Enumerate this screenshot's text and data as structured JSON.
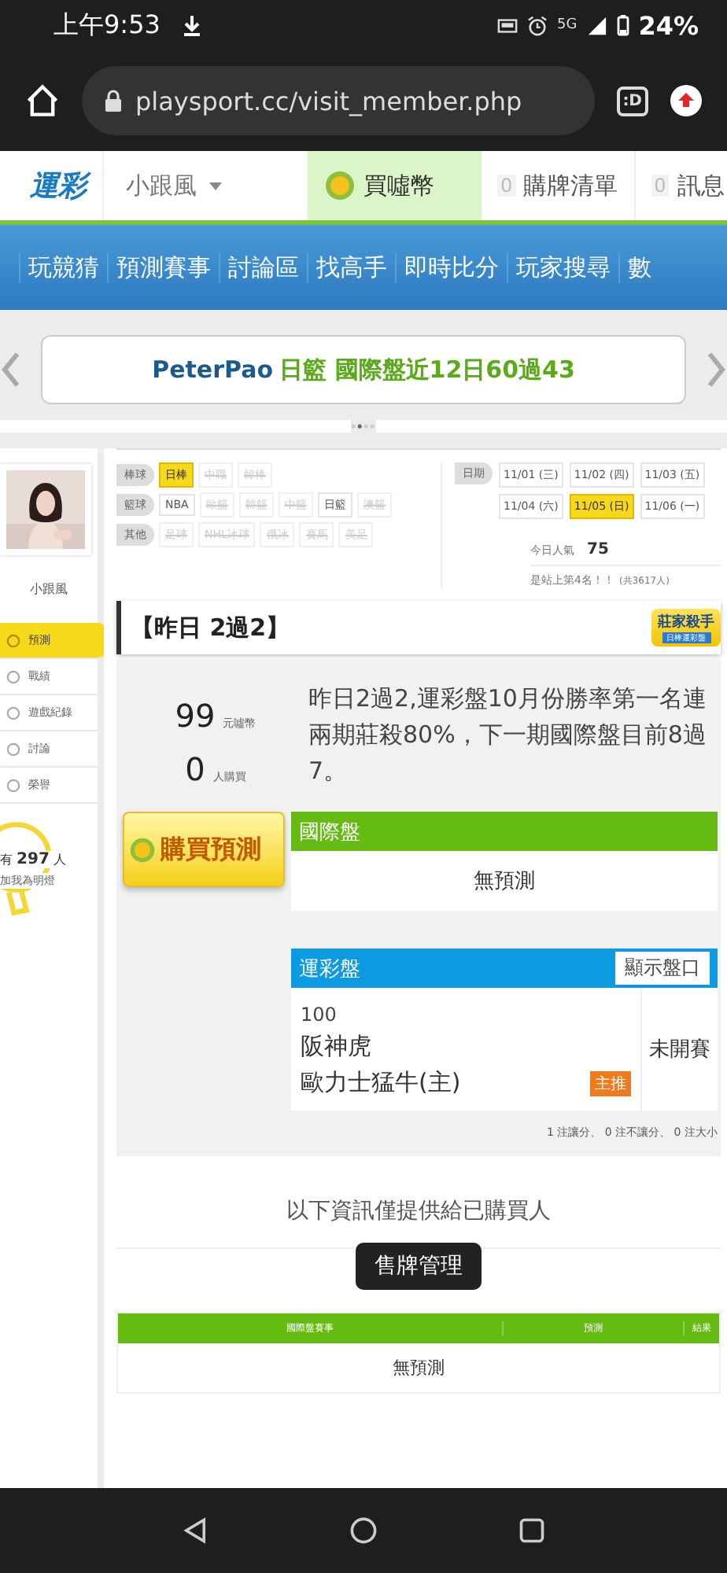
{
  "status_bar": {
    "time": "上午9:53",
    "network": "5G",
    "battery": "24%"
  },
  "browser": {
    "url": "playsport.cc/visit_member.php",
    "tab_button": ":D"
  },
  "site_header": {
    "logo": "運彩",
    "user": "小跟風",
    "buy_coin": "買噓幣",
    "cart": {
      "count": "0",
      "label": "購牌清單"
    },
    "messages": {
      "count": "0",
      "label": "訊息"
    }
  },
  "nav": [
    "玩競猜",
    "預測賽事",
    "討論區",
    "找高手",
    "即時比分",
    "玩家搜尋",
    "數"
  ],
  "banner": {
    "name": "PeterPao",
    "text": "日籃 國際盤近12日60過43"
  },
  "profile": {
    "name": "小跟風",
    "menu": [
      {
        "label": "預測",
        "selected": true
      },
      {
        "label": "戰績",
        "selected": false
      },
      {
        "label": "遊戲紀錄",
        "selected": false
      },
      {
        "label": "討論",
        "selected": false
      },
      {
        "label": "榮譽",
        "selected": false
      }
    ],
    "fans": {
      "prefix": "有",
      "count": "297",
      "unit": "人",
      "caption": "加我為明燈"
    }
  },
  "filters": {
    "groups": [
      {
        "label": "棒球",
        "items": [
          {
            "label": "日棒",
            "selected": true,
            "disabled": false
          },
          {
            "label": "中職",
            "selected": false,
            "disabled": true
          },
          {
            "label": "韓棒",
            "selected": false,
            "disabled": true
          }
        ]
      },
      {
        "label": "籃球",
        "items": [
          {
            "label": "NBA",
            "selected": false,
            "disabled": false
          },
          {
            "label": "歐籃",
            "selected": false,
            "disabled": true
          },
          {
            "label": "韓籃",
            "selected": false,
            "disabled": true
          },
          {
            "label": "中籃",
            "selected": false,
            "disabled": true
          },
          {
            "label": "日籃",
            "selected": false,
            "disabled": false
          },
          {
            "label": "澳籃",
            "selected": false,
            "disabled": true
          }
        ]
      },
      {
        "label": "其他",
        "items": [
          {
            "label": "足球",
            "selected": false,
            "disabled": true
          },
          {
            "label": "NHL冰球",
            "selected": false,
            "disabled": true
          },
          {
            "label": "俄冰",
            "selected": false,
            "disabled": true
          },
          {
            "label": "賽馬",
            "selected": false,
            "disabled": true
          },
          {
            "label": "美足",
            "selected": false,
            "disabled": true
          }
        ]
      }
    ],
    "date_label": "日期",
    "dates": [
      {
        "label": "11/01 (三)",
        "selected": false
      },
      {
        "label": "11/02 (四)",
        "selected": false
      },
      {
        "label": "11/03 (五)",
        "selected": false
      },
      {
        "label": "11/04 (六)",
        "selected": false
      },
      {
        "label": "11/05 (日)",
        "selected": true
      },
      {
        "label": "11/06 (一)",
        "selected": false
      }
    ]
  },
  "popularity": {
    "label": "今日人氣",
    "value": "75",
    "rank": "是站上第4名！！",
    "total": "(共3617人)"
  },
  "prediction": {
    "title": "【昨日 2過2】",
    "badge": {
      "title": "莊家殺手",
      "subtitle": "日棒運彩盤"
    },
    "price": "99",
    "price_unit": "元噓幣",
    "buyers": "0",
    "buyers_unit": "人購買",
    "description": "昨日2過2,運彩盤10月份勝率第一名連兩期莊殺80%，下一期國際盤目前8過7。",
    "buy_button": "購買預測",
    "international": {
      "title": "國際盤",
      "empty": "無預測"
    },
    "sports_lottery": {
      "title": "運彩盤",
      "button": "顯示盤口",
      "game": {
        "number": "100",
        "away": "阪神虎",
        "home": "歐力士猛牛(主)",
        "tag": "主推",
        "status": "未開賽"
      }
    },
    "summary": "1 注讓分、 0 注不讓分、 0 注大小"
  },
  "buyers_only": {
    "note": "以下資訊僅提供給已購買人",
    "manage_button": "售牌管理",
    "table": {
      "columns": [
        "國際盤賽事",
        "預測",
        "結果"
      ],
      "empty": "無預測"
    }
  }
}
